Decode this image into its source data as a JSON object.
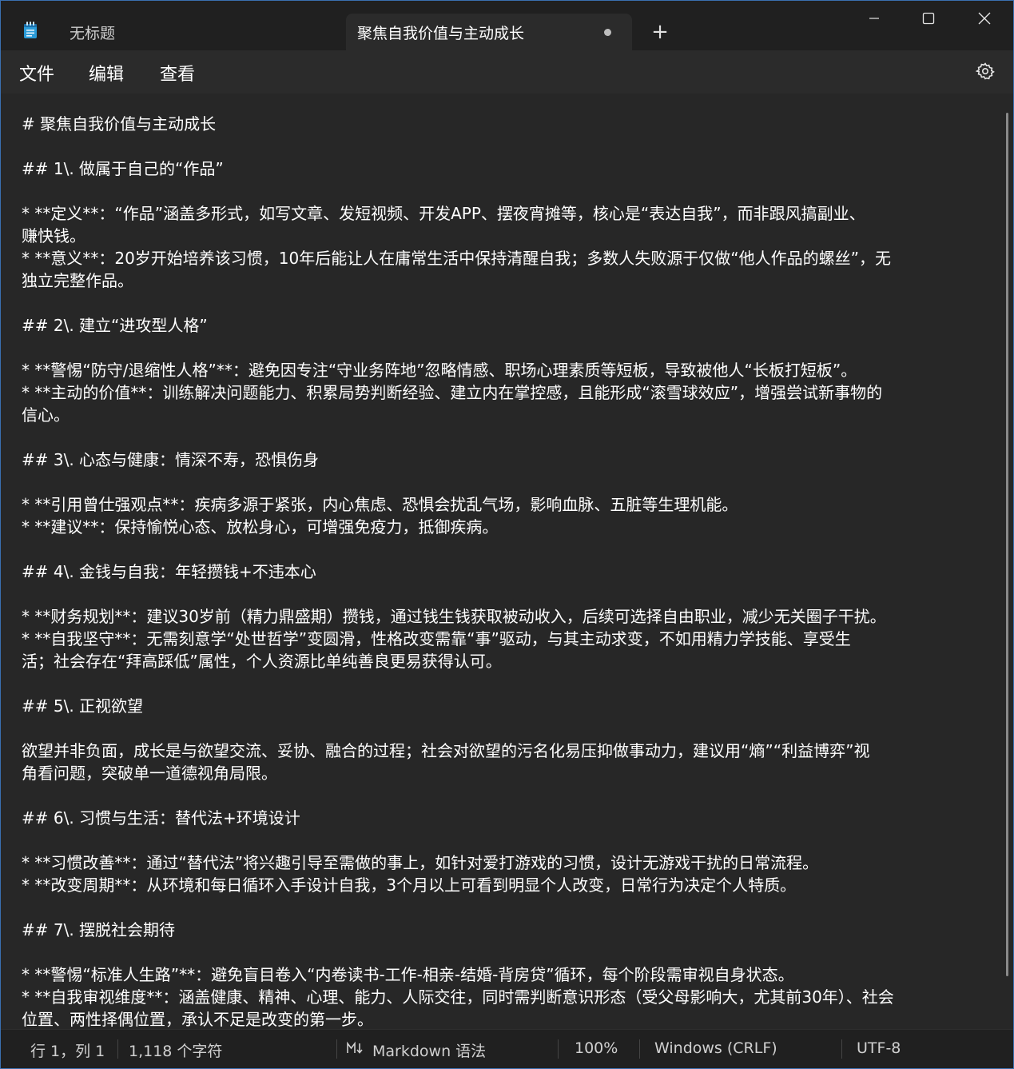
{
  "tabs": [
    {
      "label": "无标题",
      "active": false
    },
    {
      "label": "聚焦自我价值与主动成长",
      "active": true,
      "unsaved": true
    }
  ],
  "icons": {
    "app": "notepad-icon",
    "new_tab": "plus-icon",
    "minimize": "minimize-icon",
    "maximize": "maximize-icon",
    "close": "close-icon",
    "settings": "gear-icon",
    "markdown": "markdown-icon"
  },
  "titlebar": {
    "new_tab_symbol": "+"
  },
  "menu": {
    "file": "文件",
    "edit": "编辑",
    "view": "查看"
  },
  "editor": {
    "lines": [
      "# 聚焦自我价值与主动成长",
      "",
      "## 1\\. 做属于自己的“作品”",
      "",
      "* **定义**：“作品”涵盖多形式，如写文章、发短视频、开发APP、摆夜宵摊等，核心是“表达自我”，而非跟风搞副业、",
      "赚快钱。",
      "* **意义**：20岁开始培养该习惯，10年后能让人在庸常生活中保持清醒自我；多数人失败源于仅做“他人作品的螺丝”，无",
      "独立完整作品。",
      "",
      "## 2\\. 建立“进攻型人格”",
      "",
      "* **警惕“防守/退缩性人格”**：避免因专注“守业务阵地”忽略情感、职场心理素质等短板，导致被他人“长板打短板”。",
      "* **主动的价值**：训练解决问题能力、积累局势判断经验、建立内在掌控感，且能形成“滚雪球效应”，增强尝试新事物的",
      "信心。",
      "",
      "## 3\\. 心态与健康：情深不寿，恐惧伤身",
      "",
      "* **引用曾仕强观点**：疾病多源于紧张，内心焦虑、恐惧会扰乱气场，影响血脉、五脏等生理机能。",
      "* **建议**：保持愉悦心态、放松身心，可增强免疫力，抵御疾病。",
      "",
      "## 4\\. 金钱与自我：年轻攒钱+不违本心",
      "",
      "* **财务规划**：建议30岁前（精力鼎盛期）攒钱，通过钱生钱获取被动收入，后续可选择自由职业，减少无关圈子干扰。",
      "* **自我坚守**：无需刻意学“处世哲学”变圆滑，性格改变需靠“事”驱动，与其主动求变，不如用精力学技能、享受生",
      "活；社会存在“拜高踩低”属性，个人资源比单纯善良更易获得认可。",
      "",
      "## 5\\. 正视欲望",
      "",
      "欲望并非负面，成长是与欲望交流、妥协、融合的过程；社会对欲望的污名化易压抑做事动力，建议用“熵”“利益博弈”视",
      "角看问题，突破单一道德视角局限。",
      "",
      "## 6\\. 习惯与生活：替代法+环境设计",
      "",
      "* **习惯改善**：通过“替代法”将兴趣引导至需做的事上，如针对爱打游戏的习惯，设计无游戏干扰的日常流程。",
      "* **改变周期**：从环境和每日循环入手设计自我，3个月以上可看到明显个人改变，日常行为决定个人特质。",
      "",
      "## 7\\. 摆脱社会期待",
      "",
      "* **警惕“标准人生路”**：避免盲目卷入“内卷读书-工作-相亲-结婚-背房贷”循环，每个阶段需审视自身状态。",
      "* **自我审视维度**：涵盖健康、精神、心理、能力、人际交往，同时需判断意识形态（受父母影响大，尤其前30年）、社会",
      "位置、两性择偶位置，承认不足是改变的第一步。"
    ]
  },
  "status": {
    "position": "行 1，列 1",
    "char_count": "1,118 个字符",
    "syntax": "Markdown 语法",
    "zoom": "100%",
    "line_ending": "Windows (CRLF)",
    "encoding": "UTF-8"
  }
}
